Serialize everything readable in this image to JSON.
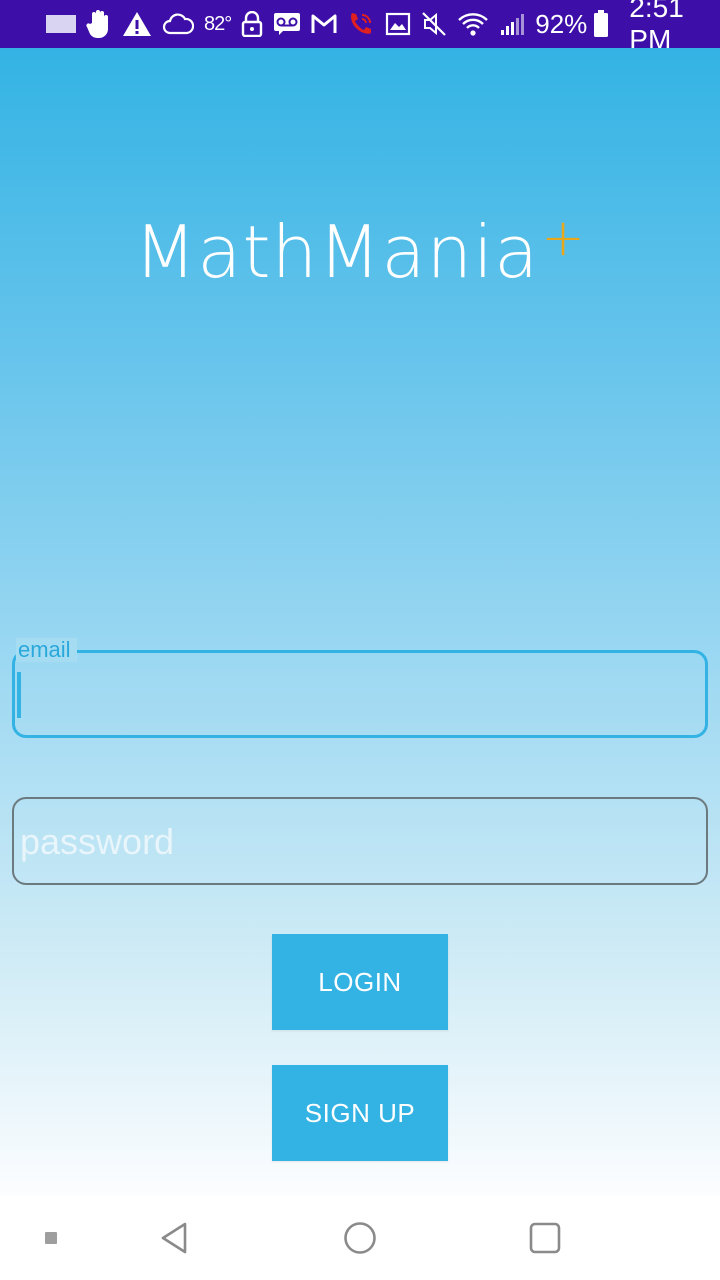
{
  "status_bar": {
    "temperature": "82°",
    "battery_percent": "92%",
    "time": "2:51 PM",
    "icons": [
      "screen-icon",
      "hand-icon",
      "warning-icon",
      "cloud-icon",
      "lock-icon",
      "voicemail-icon",
      "gmail-icon",
      "wifi-call-icon",
      "image-icon",
      "mute-icon",
      "wifi-icon",
      "signal-icon",
      "battery-icon"
    ],
    "background_color": "#3d0fa8"
  },
  "app": {
    "title": "MathMania",
    "title_suffix": "+",
    "accent_color": "#33b3e4",
    "suffix_color": "#e9a81c"
  },
  "form": {
    "email": {
      "label": "email",
      "value": ""
    },
    "password": {
      "placeholder": "password",
      "value": ""
    },
    "login_label": "LOGIN",
    "signup_label": "SIGN UP"
  },
  "nav_bar": {
    "items": [
      "recents-dot-icon",
      "back-icon",
      "home-icon",
      "overview-icon"
    ]
  }
}
